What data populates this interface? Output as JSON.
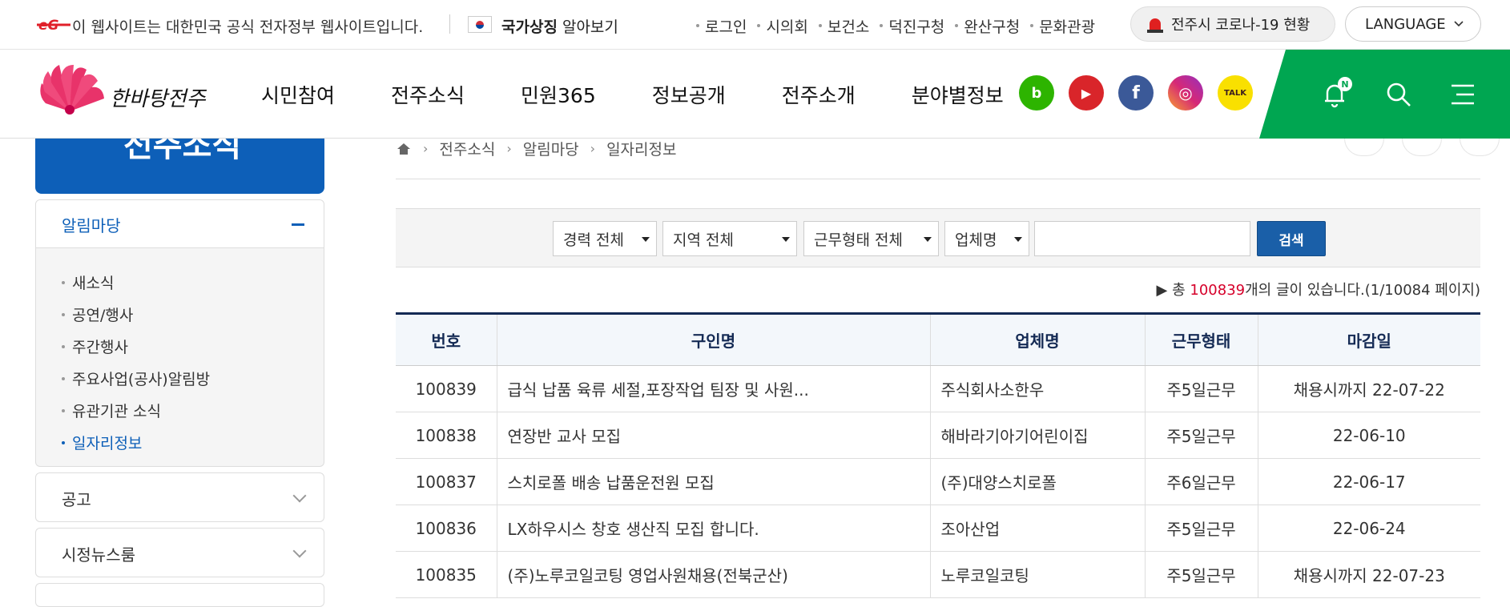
{
  "topbar": {
    "gov_notice": "이 웹사이트는 대한민국 공식 전자정부 웹사이트입니다.",
    "symbol_bold": "국가상징",
    "symbol_rest": " 알아보기",
    "links": [
      "로그인",
      "시의회",
      "보건소",
      "덕진구청",
      "완산구청",
      "문화관광"
    ],
    "corona_label": "전주시 코로나-19 현황",
    "language_label": "LANGUAGE"
  },
  "header": {
    "logo_text": "한바탕전주",
    "gnb": [
      "시민참여",
      "전주소식",
      "민원365",
      "정보공개",
      "전주소개",
      "분야별정보"
    ],
    "sns": [
      {
        "name": "blog",
        "glyph": "b",
        "color": "#2db400"
      },
      {
        "name": "youtube",
        "glyph": "▶",
        "color": "#d9252a"
      },
      {
        "name": "facebook",
        "glyph": "f",
        "color": "#3b5998"
      },
      {
        "name": "instagram",
        "glyph": "◎",
        "color": "#d62976"
      },
      {
        "name": "kakaotalk",
        "glyph": "TALK",
        "color": "#f9e000"
      }
    ],
    "notify_badge": "N",
    "accent": "#00a651"
  },
  "sidebar": {
    "banner_text": "전주소식",
    "open_menu": "알림마당",
    "subitems": [
      "새소식",
      "공연/행사",
      "주간행사",
      "주요사업(공사)알림방",
      "유관기관 소식",
      "일자리정보"
    ],
    "active_index": 5,
    "closed_menus": [
      "공고",
      "시정뉴스룸"
    ]
  },
  "breadcrumb": [
    "전주소식",
    "알림마당",
    "일자리정보"
  ],
  "search": {
    "selects": [
      "경력 전체",
      "지역 전체",
      "근무형태 전체",
      "업체명"
    ],
    "button": "검색",
    "input_value": ""
  },
  "total": {
    "prefix": "▶ 총 ",
    "count": "100839",
    "suffix": "개의 글이 있습니다.(1/10084 페이지)"
  },
  "table": {
    "headers": [
      "번호",
      "구인명",
      "업체명",
      "근무형태",
      "마감일"
    ],
    "rows": [
      [
        "100839",
        "급식 납품 육류 세절,포장작업 팀장 및 사원...",
        "주식회사소한우",
        "주5일근무",
        "채용시까지 22-07-22"
      ],
      [
        "100838",
        "연장반 교사 모집",
        "해바라기아기어린이집",
        "주5일근무",
        "22-06-10"
      ],
      [
        "100837",
        "스치로폴 배송 납품운전원 모집",
        "(주)대양스치로폴",
        "주6일근무",
        "22-06-17"
      ],
      [
        "100836",
        "LX하우시스 창호 생산직 모집 합니다.",
        "조아산업",
        "주5일근무",
        "22-06-24"
      ],
      [
        "100835",
        "(주)노루코일코팅 영업사원채용(전북군산)",
        "노루코일코팅",
        "주5일근무",
        "채용시까지 22-07-23"
      ]
    ]
  }
}
